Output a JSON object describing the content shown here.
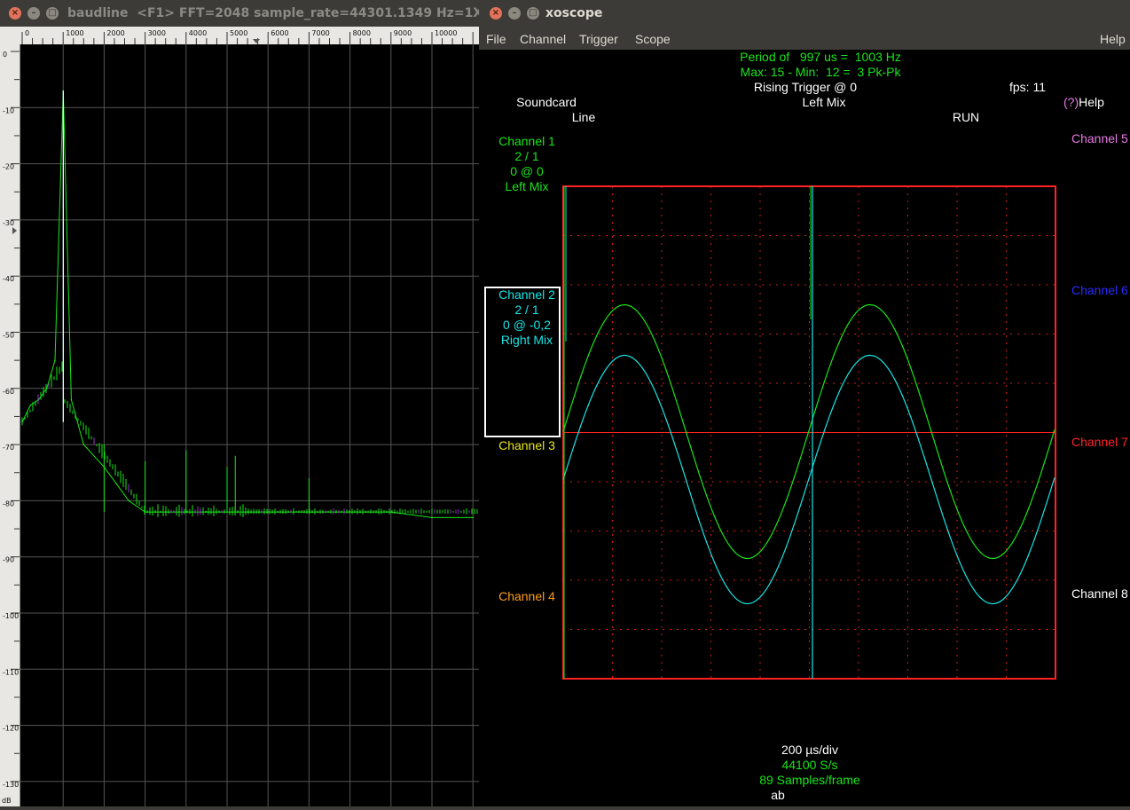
{
  "baudline": {
    "title": "baudline  <F1> FFT=2048 sample_rate=44301.1349 Hz=1X",
    "freq_ticks": [
      "0",
      "1000",
      "2000",
      "3000",
      "4000",
      "5000",
      "6000",
      "7000",
      "8000",
      "9000",
      "10000"
    ],
    "db_ticks": [
      "0",
      "-10",
      "-20",
      "-30",
      "-40",
      "-50",
      "-60",
      "-70",
      "-80",
      "-90",
      "-100",
      "-110",
      "-120",
      "-130"
    ],
    "db_unit": "dB"
  },
  "xoscope": {
    "title": "xoscope",
    "menu": {
      "file": "File",
      "channel": "Channel",
      "trigger": "Trigger",
      "scope": "Scope",
      "help": "Help"
    },
    "status": {
      "period": "Period of   997 us =  1003 Hz",
      "maxmin": "Max: 15 - Min:  12 =  3 Pk-Pk",
      "trigger": "Rising Trigger @ 0",
      "fps": "fps: 11",
      "source": "Soundcard",
      "input": "Line",
      "mix": "Left Mix",
      "run": "RUN",
      "help_q": "(?)",
      "help_txt": "Help"
    },
    "channels": {
      "ch1": {
        "name": "Channel 1",
        "scale": "2 / 1",
        "pos": "0 @ 0",
        "src": "Left Mix"
      },
      "ch2": {
        "name": "Channel 2",
        "scale": "2 / 1",
        "pos": "0 @ -0,2",
        "src": "Right Mix"
      },
      "ch3": {
        "name": "Channel 3"
      },
      "ch4": {
        "name": "Channel 4"
      },
      "ch5": {
        "name": "Channel 5"
      },
      "ch6": {
        "name": "Channel 6"
      },
      "ch7": {
        "name": "Channel 7"
      },
      "ch8": {
        "name": "Channel 8"
      }
    },
    "timebase": "200 µs/div",
    "sample_rate": "44100 S/s",
    "samples_frame": "89 Samples/frame",
    "footer_mark": "ab"
  },
  "colors": {
    "ch1": "#19e519",
    "ch2": "#19e5e5",
    "ch3": "#e5e519",
    "ch4": "#ff9d1a",
    "ch5": "#e57ae5",
    "ch6": "#2b2bff",
    "ch7": "#ff2222",
    "ch8": "#ffffff",
    "grid": "#ff2222"
  },
  "chart_data": {
    "type": "line",
    "x_unit": "Hz",
    "y_unit": "dB",
    "xlim": [
      0,
      11000
    ],
    "ylim": [
      -135,
      0
    ],
    "series": [
      {
        "x": [
          0,
          200,
          400,
          600,
          800,
          1003,
          1200,
          1500,
          2000,
          2300,
          2600,
          3000,
          3500,
          4000,
          4500,
          5000,
          5500,
          6000,
          7000,
          8000,
          9000,
          10000,
          11000
        ],
        "y": [
          -66,
          -63,
          -62,
          -60,
          -55,
          -7,
          -62,
          -70,
          -74,
          -77,
          -80,
          -82,
          -82,
          -82,
          -82,
          -82,
          -82,
          -82,
          -82,
          -82,
          -82,
          -83,
          -83
        ]
      }
    ]
  }
}
